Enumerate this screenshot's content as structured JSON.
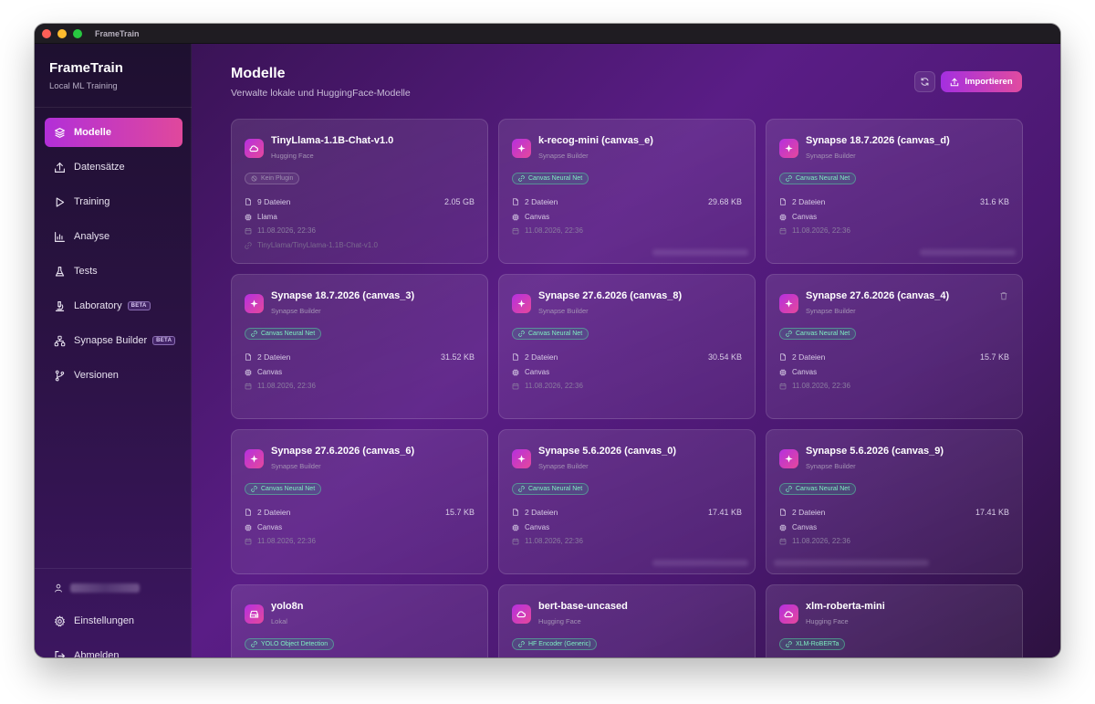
{
  "window": {
    "title": "FrameTrain"
  },
  "sidebar": {
    "brand": "FrameTrain",
    "subtitle": "Local ML Training",
    "items": [
      {
        "label": "Modelle",
        "icon": "layers-icon",
        "active": true
      },
      {
        "label": "Datensätze",
        "icon": "upload-icon"
      },
      {
        "label": "Training",
        "icon": "play-icon"
      },
      {
        "label": "Analyse",
        "icon": "bar-chart-icon"
      },
      {
        "label": "Tests",
        "icon": "flask-icon"
      },
      {
        "label": "Laboratory",
        "icon": "microscope-icon",
        "badge": "BETA"
      },
      {
        "label": "Synapse Builder",
        "icon": "network-icon",
        "badge": "BETA"
      },
      {
        "label": "Versionen",
        "icon": "git-branch-icon"
      }
    ],
    "bottom": [
      {
        "label": "Einstellungen",
        "icon": "gear-icon"
      },
      {
        "label": "Abmelden",
        "icon": "logout-icon"
      }
    ]
  },
  "header": {
    "title": "Modelle",
    "subtitle": "Verwalte lokale und HuggingFace-Modelle",
    "import_label": "Importieren"
  },
  "cards": [
    {
      "title": "TinyLlama-1.1B-Chat-v1.0",
      "source": "Hugging Face",
      "badge": "Kein Plugin",
      "files": "9 Dateien",
      "size": "2.05 GB",
      "arch": "Llama",
      "date": "11.08.2026, 22:36",
      "path": "TinyLlama/TinyLlama-1.1B-Chat-v1.0"
    },
    {
      "title": "k-recog-mini (canvas_e)",
      "source": "Synapse Builder",
      "badge": "Canvas Neural Net",
      "files": "2 Dateien",
      "size": "29.68 KB",
      "arch": "Canvas",
      "date": "11.08.2026, 22:36"
    },
    {
      "title": "Synapse 18.7.2026 (canvas_d)",
      "source": "Synapse Builder",
      "badge": "Canvas Neural Net",
      "files": "2 Dateien",
      "size": "31.6 KB",
      "arch": "Canvas",
      "date": "11.08.2026, 22:36"
    },
    {
      "title": "Synapse 18.7.2026 (canvas_3)",
      "source": "Synapse Builder",
      "badge": "Canvas Neural Net",
      "files": "2 Dateien",
      "size": "31.52 KB",
      "arch": "Canvas",
      "date": "11.08.2026, 22:36"
    },
    {
      "title": "Synapse 27.6.2026 (canvas_8)",
      "source": "Synapse Builder",
      "badge": "Canvas Neural Net",
      "files": "2 Dateien",
      "size": "30.54 KB",
      "arch": "Canvas",
      "date": "11.08.2026, 22:36"
    },
    {
      "title": "Synapse 27.6.2026 (canvas_4)",
      "source": "Synapse Builder",
      "badge": "Canvas Neural Net",
      "files": "2 Dateien",
      "size": "15.7 KB",
      "arch": "Canvas",
      "date": "11.08.2026, 22:36"
    },
    {
      "title": "Synapse 27.6.2026 (canvas_6)",
      "source": "Synapse Builder",
      "badge": "Canvas Neural Net",
      "files": "2 Dateien",
      "size": "15.7 KB",
      "arch": "Canvas",
      "date": "11.08.2026, 22:36"
    },
    {
      "title": "Synapse 5.6.2026 (canvas_0)",
      "source": "Synapse Builder",
      "badge": "Canvas Neural Net",
      "files": "2 Dateien",
      "size": "17.41 KB",
      "arch": "Canvas",
      "date": "11.08.2026, 22:36"
    },
    {
      "title": "Synapse 5.6.2026 (canvas_9)",
      "source": "Synapse Builder",
      "badge": "Canvas Neural Net",
      "files": "2 Dateien",
      "size": "17.41 KB",
      "arch": "Canvas",
      "date": "11.08.2026, 22:36"
    },
    {
      "title": "yolo8n",
      "source": "Lokal",
      "badge": "YOLO Object Detection"
    },
    {
      "title": "bert-base-uncased",
      "source": "Hugging Face",
      "badge": "HF Encoder (Generic)"
    },
    {
      "title": "xlm-roberta-mini",
      "source": "Hugging Face",
      "badge": "XLM-RoBERTa"
    }
  ],
  "colors": {
    "accent_from": "#b22fd8",
    "accent_to": "#e0489c",
    "badge_green": "#7ff0c2"
  }
}
